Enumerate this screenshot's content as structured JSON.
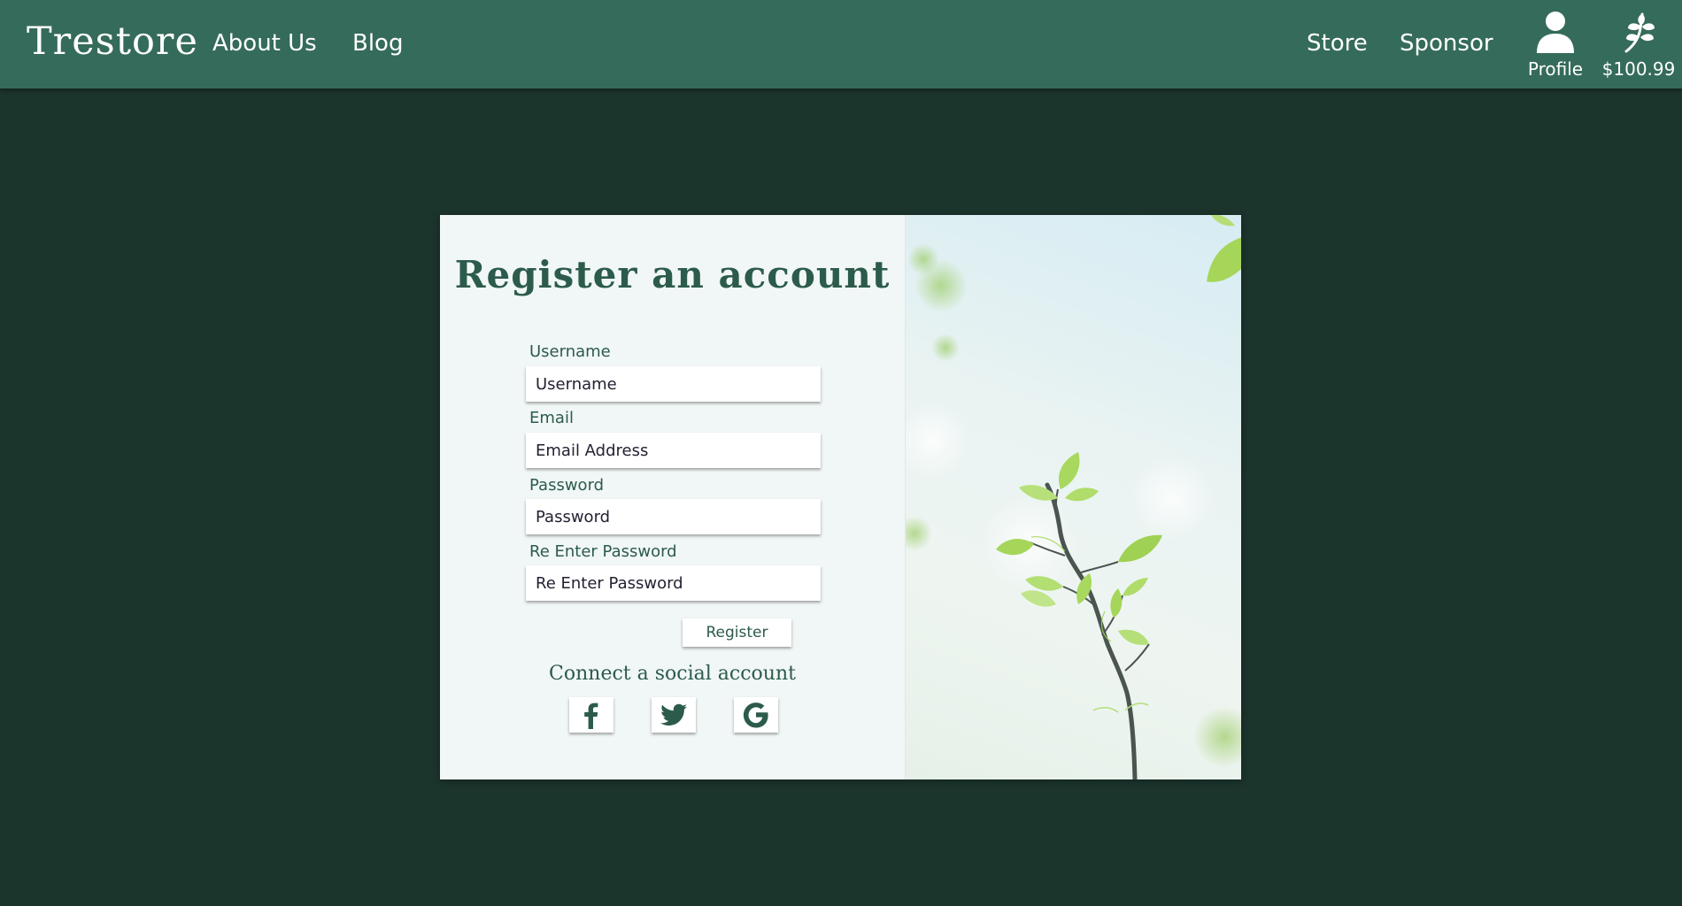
{
  "navbar": {
    "brand": "Trestore",
    "links": {
      "about": "About Us",
      "blog": "Blog",
      "store": "Store",
      "sponsor": "Sponsor"
    },
    "profile_label": "Profile",
    "wallet_amount": "$100.99",
    "icons": {
      "profile": "user-icon",
      "wallet": "sprout-icon"
    }
  },
  "form": {
    "title": "Register an account",
    "fields": [
      {
        "label": "Username",
        "placeholder": "Username"
      },
      {
        "label": "Email",
        "placeholder": "Email Address"
      },
      {
        "label": "Password",
        "placeholder": "Password"
      },
      {
        "label": "Re Enter Password",
        "placeholder": "Re Enter Password"
      }
    ],
    "register_label": "Register",
    "social_heading": "Connect a social account",
    "social_icons": [
      "facebook-icon",
      "twitter-icon",
      "google-icon"
    ]
  },
  "colors": {
    "page_background": "#1b342c",
    "navbar": "#356b5a",
    "card": "#f1f7f6",
    "accent_text": "#2c5b4c"
  }
}
